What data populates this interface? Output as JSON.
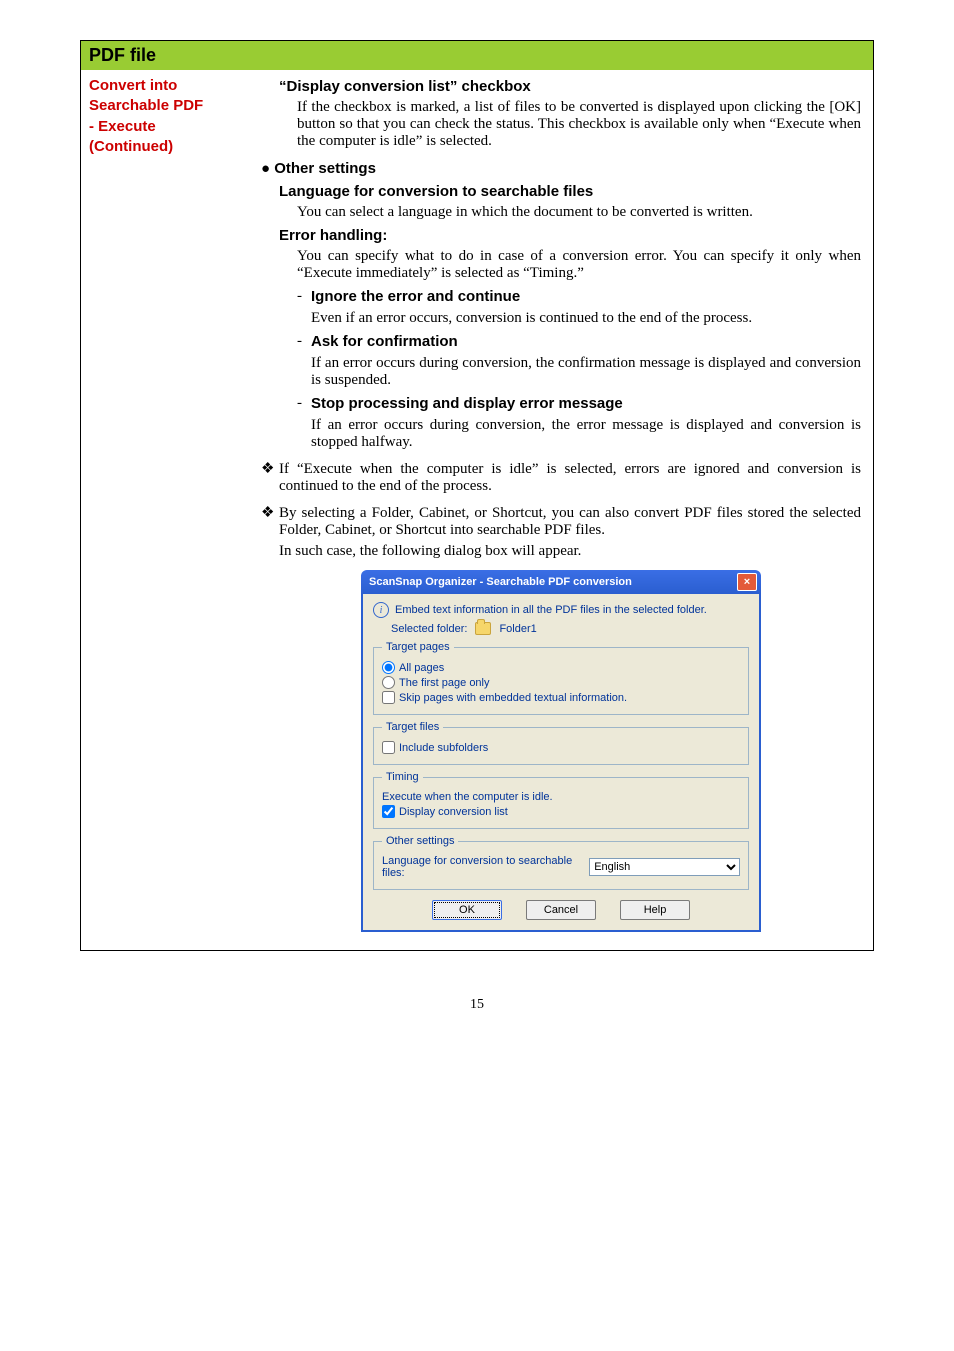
{
  "page_number": "15",
  "section_header": "PDF file",
  "left_col": {
    "l1": "Convert into",
    "l2": "Searchable PDF",
    "l3": "- Execute",
    "l4": "(Continued)"
  },
  "h_display_checkbox": "“Display conversion list” checkbox",
  "p_display_checkbox": "If the checkbox is marked, a list of files to be converted is displayed upon clicking the [OK] button so that you can check the status. This checkbox is available only when “Execute when the computer is idle” is selected.",
  "bullet_other": "● Other settings",
  "h_lang": "Language for conversion to searchable files",
  "p_lang": "You can select a language in which the document to be converted is written.",
  "h_err": "Error handling:",
  "p_err": "You can specify what to do in case of a conversion error. You can specify it only when “Execute immediately” is selected as “Timing.”",
  "dash1_h": "Ignore the error and continue",
  "dash1_b": "Even if an error occurs, conversion is continued to the end of the process.",
  "dash2_h": "Ask for confirmation",
  "dash2_b": "If an error occurs during conversion, the confirmation message is displayed and conversion is suspended.",
  "dash3_h": "Stop processing and display error message",
  "dash3_b": "If an error occurs during conversion, the error message is displayed and conversion is stopped halfway.",
  "diamond1": "If “Execute when the computer is idle” is selected, errors are ignored and conversion is continued to the end of the process.",
  "diamond2a": "By selecting a Folder, Cabinet, or Shortcut, you can also convert PDF files stored the selected Folder, Cabinet, or Shortcut into searchable PDF files.",
  "diamond2b": "In such case, the following dialog box will appear.",
  "dialog": {
    "title": "ScanSnap Organizer - Searchable PDF conversion",
    "info_text": "Embed text information in all the PDF files in the selected folder.",
    "selected_label": "Selected folder:",
    "selected_value": "Folder1",
    "fs_target_pages": "Target pages",
    "radio_all": "All pages",
    "radio_first": "The first page only",
    "chk_skip": "Skip pages with embedded textual information.",
    "fs_target_files": "Target files",
    "chk_subfolders": "Include subfolders",
    "fs_timing": "Timing",
    "timing_text": "Execute when the computer is idle.",
    "chk_display_list": "Display conversion list",
    "fs_other": "Other settings",
    "lang_label": "Language for conversion to searchable files:",
    "lang_value": "English",
    "btn_ok": "OK",
    "btn_cancel": "Cancel",
    "btn_help": "Help"
  }
}
